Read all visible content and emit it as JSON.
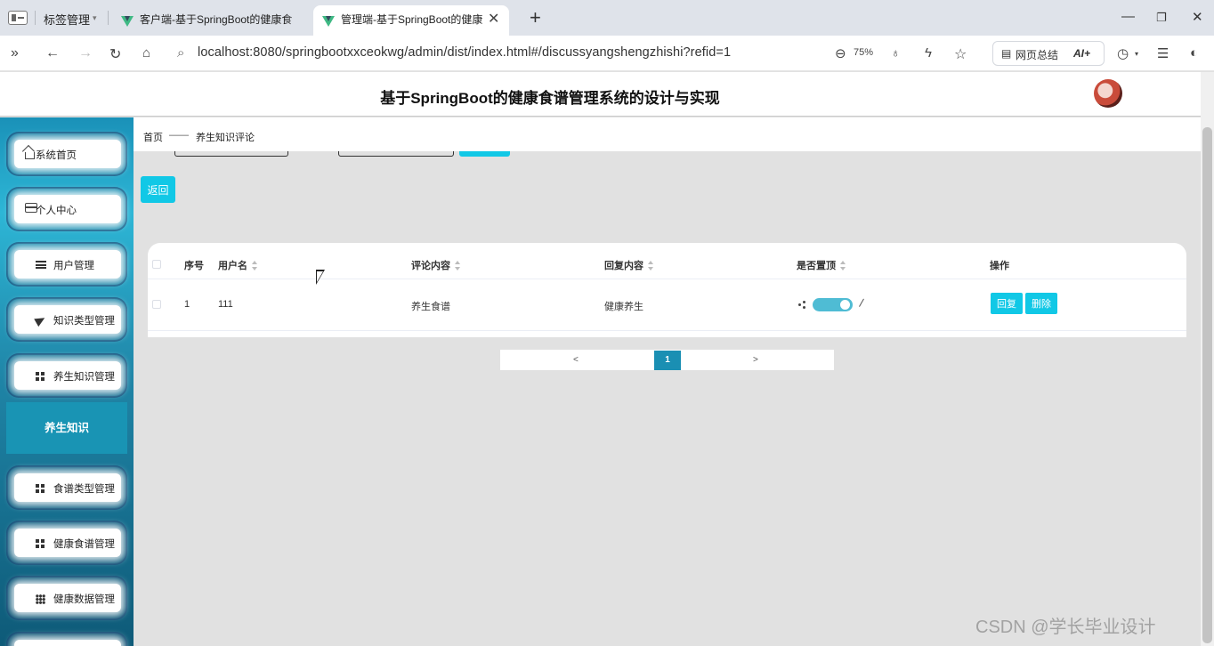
{
  "browser": {
    "tab_group_label": "标签管理",
    "tabs": [
      {
        "title": "客户端-基于SpringBoot的健康食"
      },
      {
        "title": "管理端-基于SpringBoot的健康"
      }
    ],
    "url": "localhost:8080/springbootxxceokwg/admin/dist/index.html#/discussyangshengzhishi?refid=1",
    "zoom": "75%",
    "summary_label": "网页总结",
    "ai_label": "AI+"
  },
  "header": {
    "title": "基于SpringBoot的健康食谱管理系统的设计与实现"
  },
  "sidebar": {
    "items": [
      {
        "label": "系统首页",
        "icon": "home-icon"
      },
      {
        "label": "个人中心",
        "icon": "card-icon"
      },
      {
        "label": "用户管理",
        "icon": "list-icon"
      },
      {
        "label": "知识类型管理",
        "icon": "send-icon"
      },
      {
        "label": "养生知识管理",
        "icon": "grid-icon"
      }
    ],
    "active_sub": "养生知识",
    "items2": [
      {
        "label": "食谱类型管理",
        "icon": "grid-icon"
      },
      {
        "label": "健康食谱管理",
        "icon": "grid-icon"
      },
      {
        "label": "健康数据管理",
        "icon": "grid9-icon"
      }
    ]
  },
  "breadcrumb": {
    "home": "首页",
    "sep": "——",
    "current": "养生知识评论"
  },
  "back_label": "返回",
  "table": {
    "headers": {
      "index": "序号",
      "username": "用户名",
      "comment": "评论内容",
      "reply": "回复内容",
      "pinned": "是否置顶",
      "actions": "操作"
    },
    "rows": [
      {
        "index": "1",
        "username": "111",
        "comment": "养生食谱",
        "reply": "健康养生",
        "pinned": true,
        "reply_btn": "回复",
        "delete_btn": "删除"
      }
    ]
  },
  "pagination": {
    "prev": "<",
    "current": "1",
    "next": ">"
  },
  "watermark": "CSDN @学长毕业设计"
}
